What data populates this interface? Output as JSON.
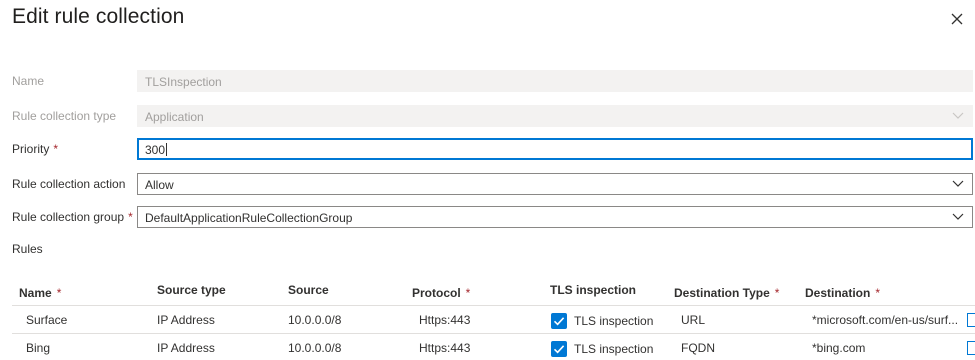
{
  "panel": {
    "title": "Edit rule collection",
    "close_icon": "close-icon"
  },
  "form": {
    "name": {
      "label": "Name",
      "value": "TLSInspection"
    },
    "type": {
      "label": "Rule collection type",
      "value": "Application"
    },
    "priority": {
      "label": "Priority",
      "required": "*",
      "value": "300"
    },
    "action": {
      "label": "Rule collection action",
      "value": "Allow"
    },
    "group": {
      "label": "Rule collection group",
      "required": "*",
      "value": "DefaultApplicationRuleCollectionGroup"
    }
  },
  "rules": {
    "label": "Rules",
    "columns": {
      "name": "Name",
      "source_type": "Source type",
      "source": "Source",
      "protocol": "Protocol",
      "tls": "TLS inspection",
      "dest_type": "Destination Type",
      "destination": "Destination",
      "required": "*"
    },
    "rows": [
      {
        "name": "Surface",
        "source_type": "IP Address",
        "source": "10.0.0.0/8",
        "protocol": "Https:443",
        "tls": "TLS inspection",
        "dest_type": "URL",
        "destination": "*microsoft.com/en-us/surf..."
      },
      {
        "name": "Bing",
        "source_type": "IP Address",
        "source": "10.0.0.0/8",
        "protocol": "Https:443",
        "tls": "TLS inspection",
        "dest_type": "FQDN",
        "destination": "*bing.com"
      }
    ]
  },
  "colors": {
    "accent": "#0078d4",
    "required": "#a4262c",
    "disabled_bg": "#f3f2f1",
    "disabled_text": "#a19f9d"
  }
}
